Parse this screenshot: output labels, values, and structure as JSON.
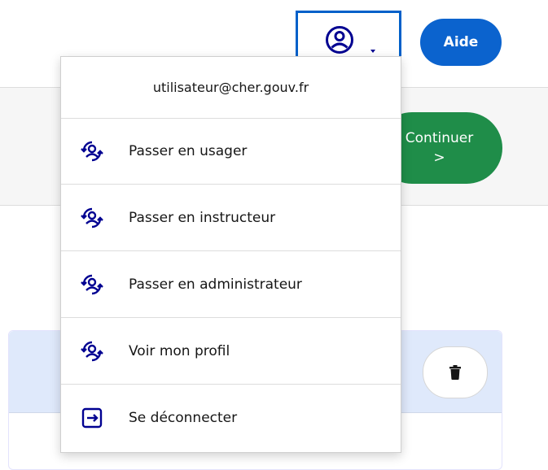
{
  "header": {
    "account_icon": "user-circle-icon",
    "help_label": "Aide"
  },
  "menu": {
    "email": "utilisateur@cher.gouv.fr",
    "items": [
      {
        "label": "Passer en usager",
        "icon": "switch-user-icon"
      },
      {
        "label": "Passer en instructeur",
        "icon": "switch-user-icon"
      },
      {
        "label": "Passer en administrateur",
        "icon": "switch-user-icon"
      },
      {
        "label": "Voir mon profil",
        "icon": "switch-user-icon"
      },
      {
        "label": "Se déconnecter",
        "icon": "logout-icon"
      }
    ]
  },
  "page": {
    "continue_label": "Continuer",
    "continue_arrow": ">"
  },
  "colors": {
    "primary_blue": "#0b63ce",
    "green": "#1f8d49",
    "light_blue": "#dfe9fb"
  }
}
